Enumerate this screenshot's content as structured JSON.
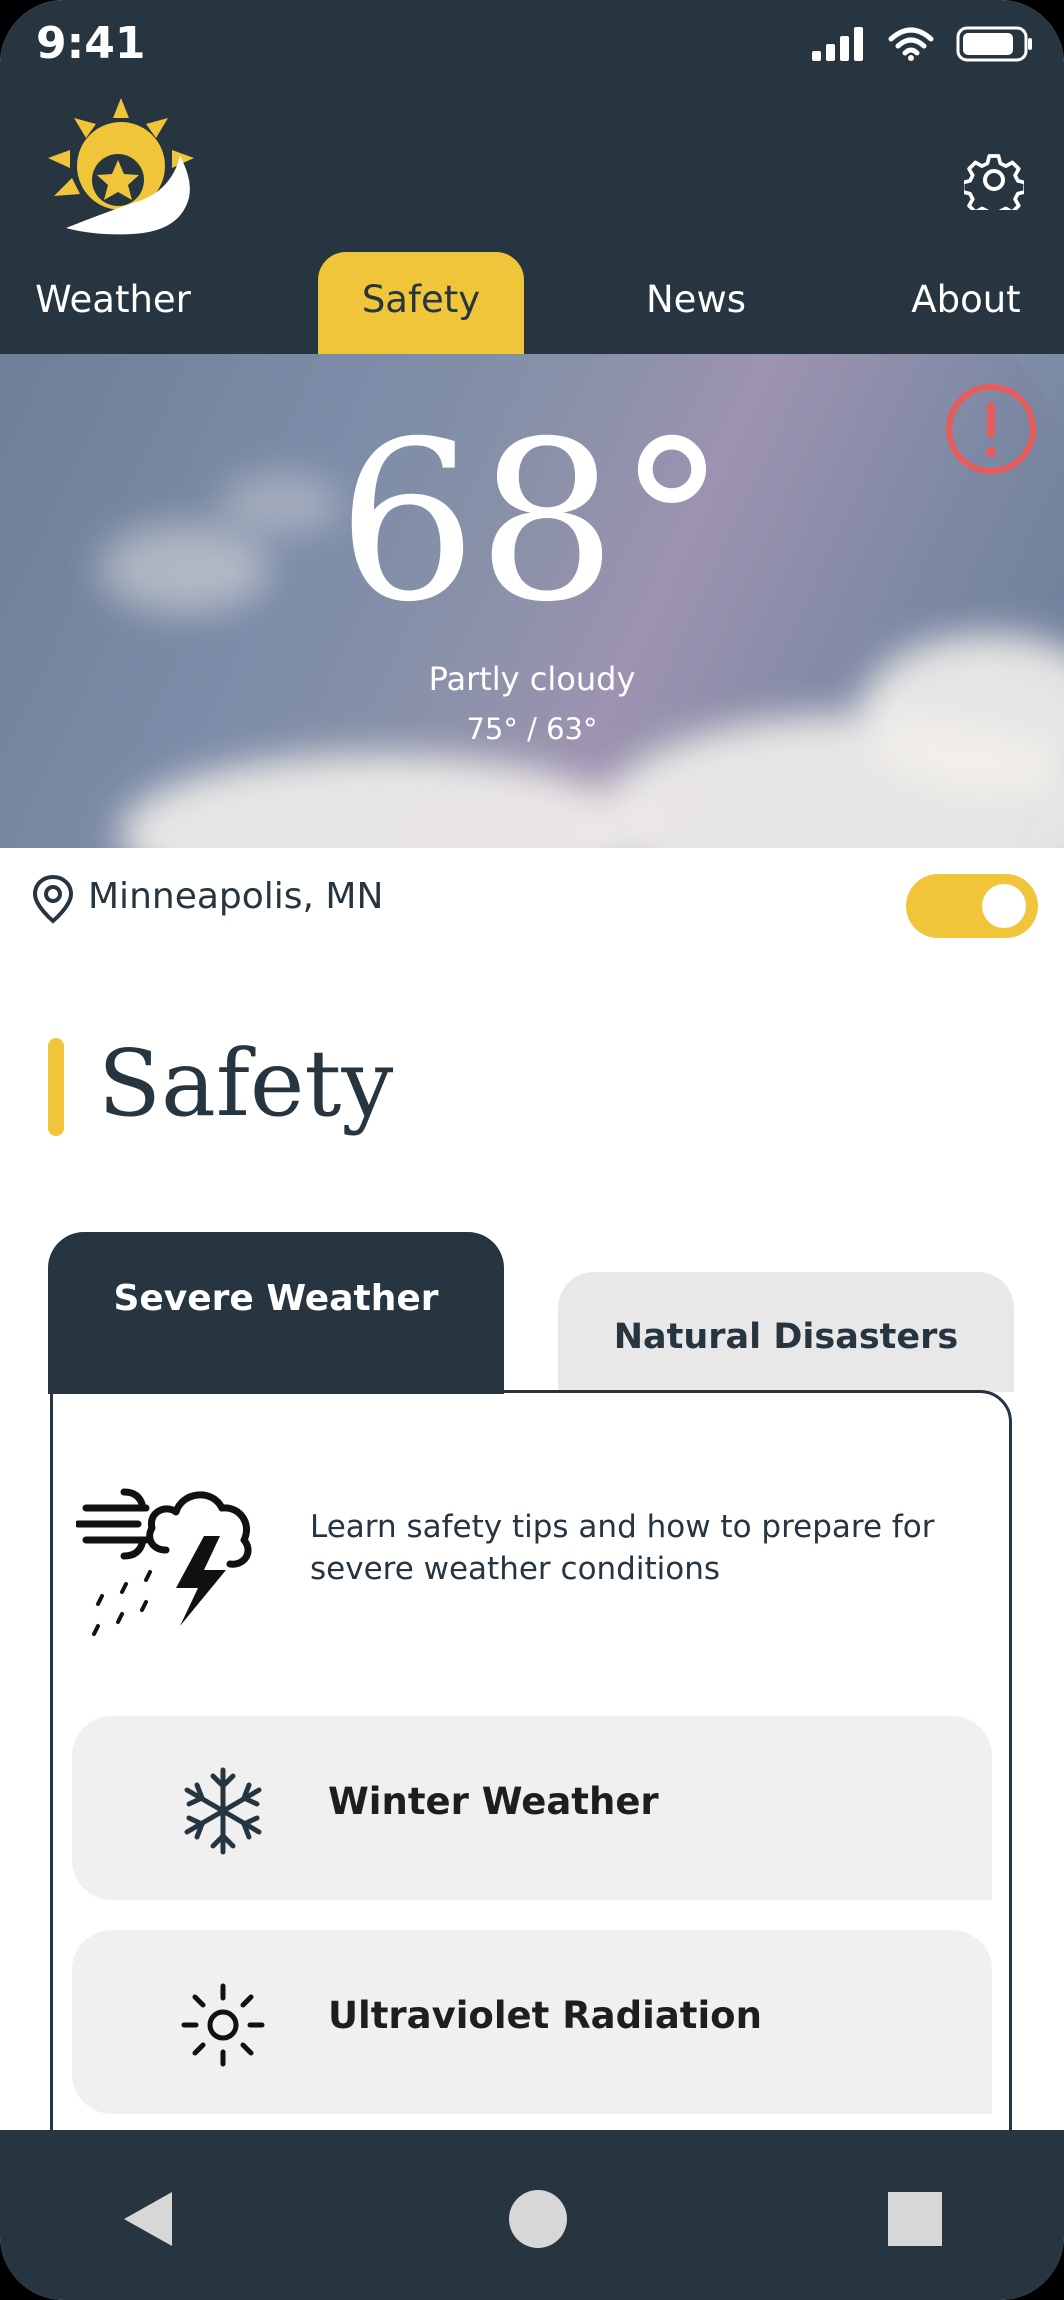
{
  "status_bar": {
    "time": "9:41"
  },
  "nav": {
    "tabs": [
      {
        "label": "Weather"
      },
      {
        "label": "Safety"
      },
      {
        "label": "News"
      },
      {
        "label": "About"
      }
    ]
  },
  "weather": {
    "temperature": "68°",
    "condition": "Partly cloudy",
    "high_low": "75° / 63°"
  },
  "location": {
    "name": "Minneapolis, MN",
    "toggle_on": true
  },
  "section": {
    "title": "Safety"
  },
  "safety_tabs": {
    "active": "Severe Weather",
    "inactive": "Natural Disasters"
  },
  "intro": {
    "text": "Learn safety tips and how to prepare for severe weather conditions"
  },
  "items": [
    {
      "label": "Winter Weather",
      "icon": "snowflake-icon"
    },
    {
      "label": "Ultraviolet Radiation",
      "icon": "sun-icon"
    }
  ],
  "colors": {
    "dark": "#263540",
    "accent": "#f1c53a",
    "alert": "#e85b5b",
    "card_gray": "#f0f0f0"
  }
}
